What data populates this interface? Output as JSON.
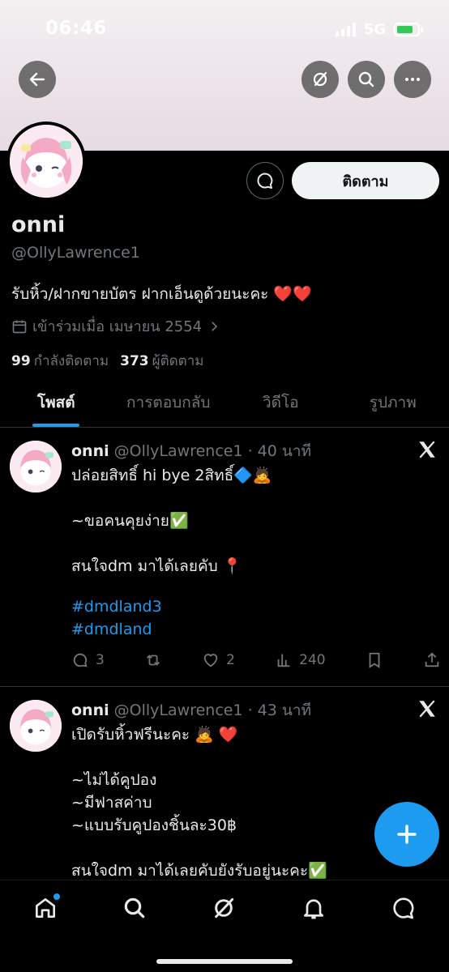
{
  "status_bar": {
    "time": "06:46",
    "network": "5G"
  },
  "profile": {
    "name": "onni",
    "handle": "@OllyLawrence1",
    "bio": "รับหิ้ว/ฝากขายบัตร ฝากเอ็นดูด้วยนะคะ ❤️❤️",
    "joined": "เข้าร่วมเมื่อ เมษายน 2554",
    "following_count": "99",
    "following_label": "กำลังติดตาม",
    "followers_count": "373",
    "followers_label": "ผู้ติดตาม",
    "follow_label": "ติดตาม"
  },
  "tabs": [
    {
      "label": "โพสต์"
    },
    {
      "label": "การตอบกลับ"
    },
    {
      "label": "วิดีโอ"
    },
    {
      "label": "รูปภาพ"
    }
  ],
  "tweets": [
    {
      "name": "onni",
      "handle_time": "@OllyLawrence1 · 40 นาที",
      "lines": [
        "ปล่อยสิทธิ์ hi bye 2สิทธิ์🔷🙇",
        "~ขอคนคุยง่าย✅",
        "สนใจdm มาได้เลยคับ 📍"
      ],
      "hashtags": [
        "#dmdland3",
        "#dmdland"
      ],
      "replies": "3",
      "likes": "2",
      "views": "240"
    },
    {
      "name": "onni",
      "handle_time": "@OllyLawrence1 · 43 นาที",
      "lines": [
        "เปิดรับหิ้วฟรีนะคะ 🙇 ❤️",
        "~ไม่ได้คูปอง",
        "~มีฟาสค่าบ",
        "~แบบรับคูปองชิ้นละ30฿",
        "สนใจdm มาได้เลยคับยังรับอยู่นะคะ✅"
      ]
    }
  ],
  "colors": {
    "accent": "#1d9bf0",
    "background": "#000000",
    "muted": "#71767b"
  },
  "icons": [
    "back-arrow-icon",
    "grok-icon",
    "search-icon",
    "more-icon",
    "message-icon",
    "calendar-icon",
    "chevron-right-icon",
    "x-logo-icon",
    "reply-icon",
    "retweet-icon",
    "like-icon",
    "views-icon",
    "bookmark-icon",
    "share-icon",
    "compose-plus-icon",
    "home-icon",
    "notifications-icon",
    "messages-icon"
  ]
}
